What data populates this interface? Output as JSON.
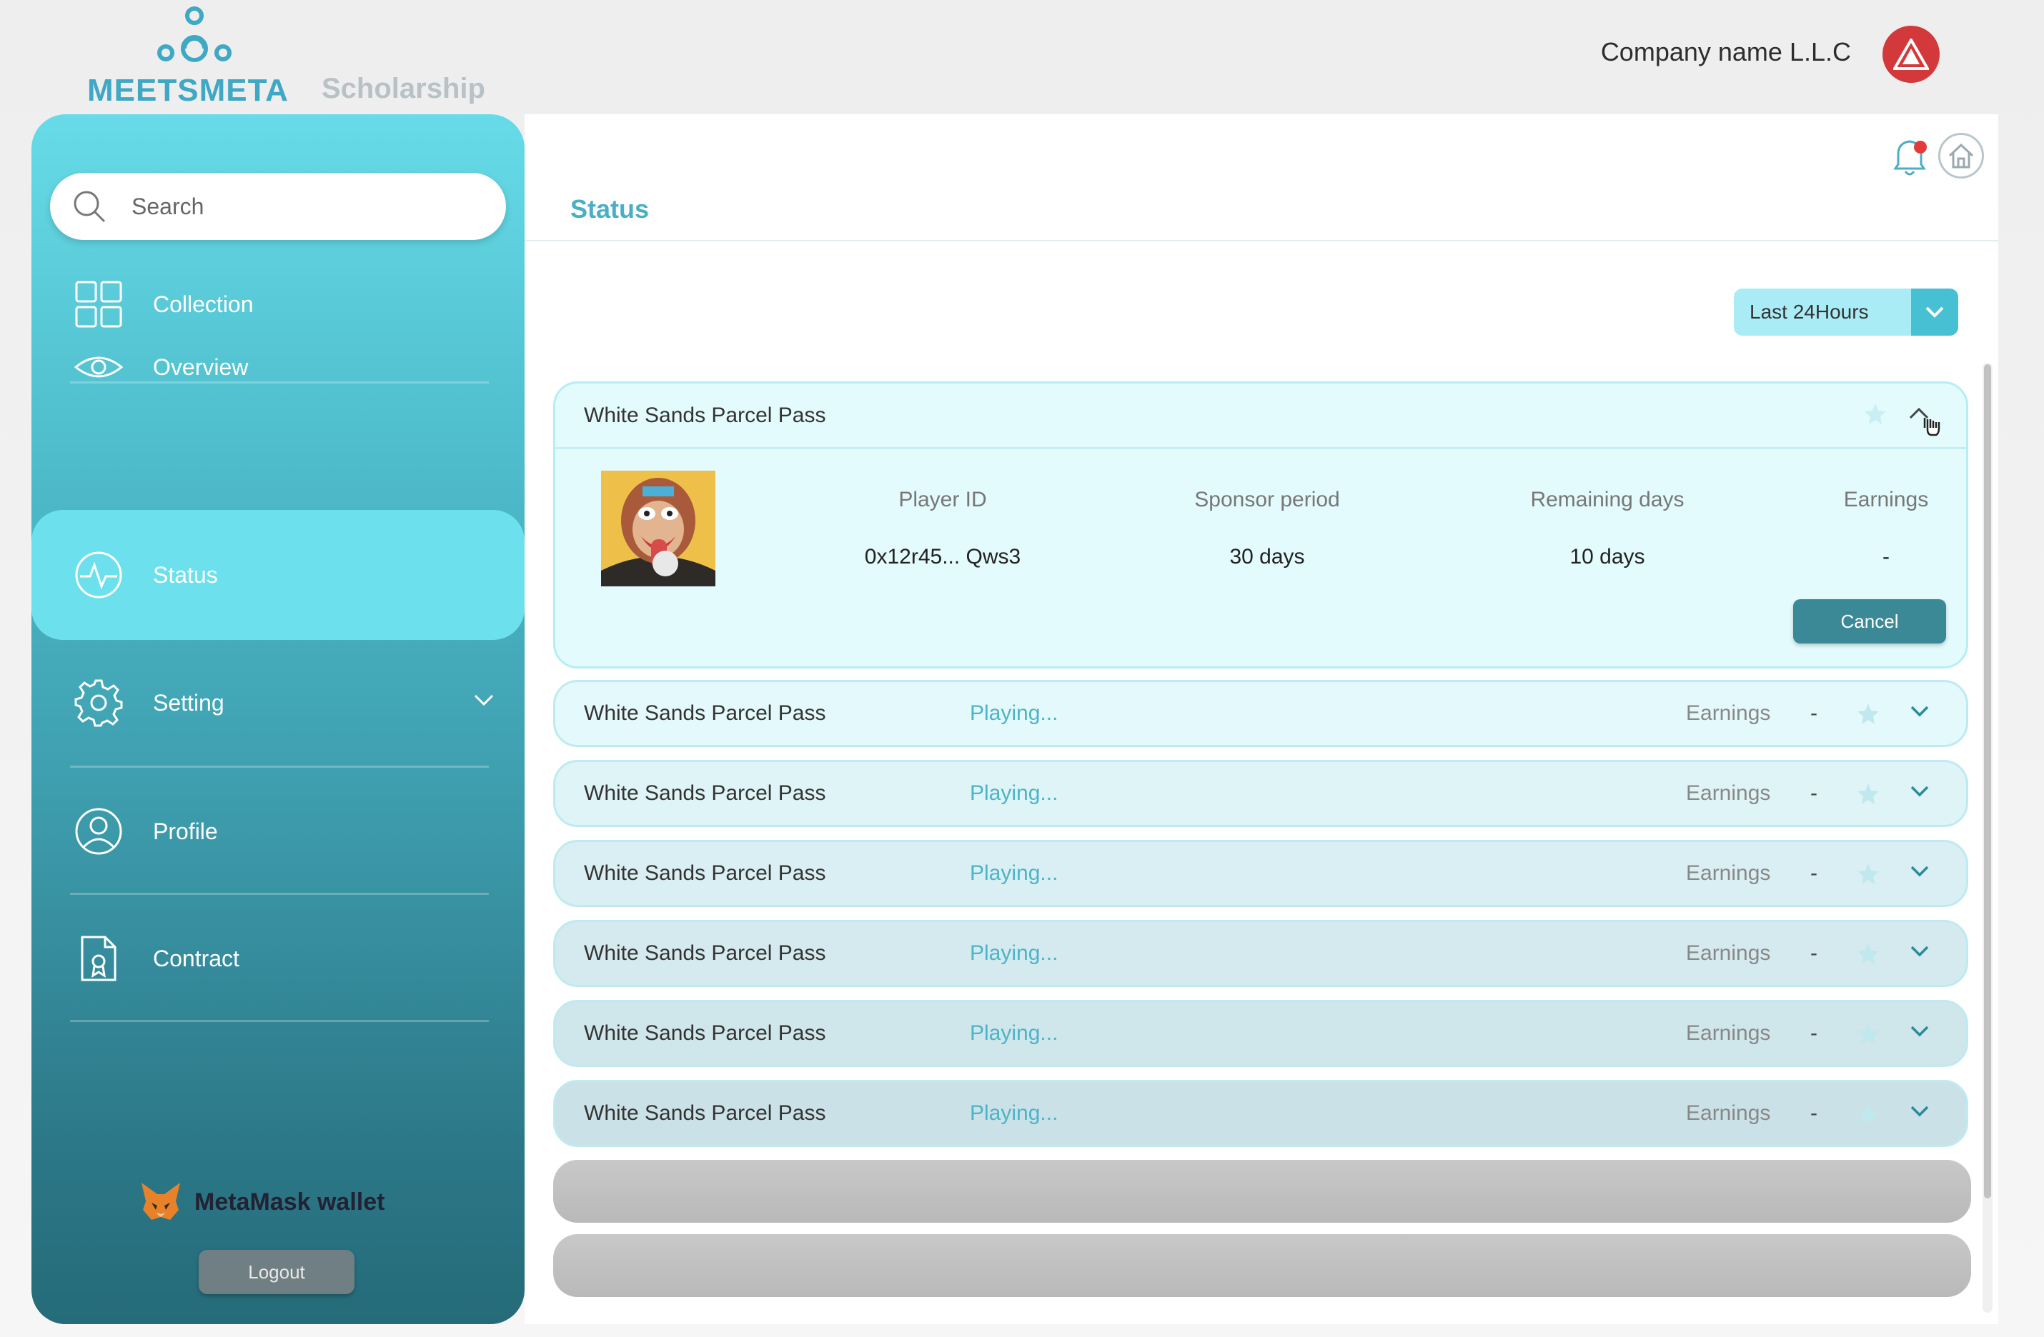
{
  "brand": {
    "name": "MEETSMETA",
    "product": "Scholarship"
  },
  "company": {
    "name": "Company name L.L.C"
  },
  "sidebar": {
    "search_placeholder": "Search",
    "items": [
      {
        "label": "Collection",
        "icon": "grid-icon"
      },
      {
        "label": "Overview",
        "icon": "eye-icon"
      },
      {
        "label": "Status",
        "icon": "activity-icon",
        "active": true
      },
      {
        "label": "Setting",
        "icon": "gear-icon"
      },
      {
        "label": "Profile",
        "icon": "user-circle-icon"
      },
      {
        "label": "Contract",
        "icon": "document-icon"
      }
    ],
    "wallet_label": "MetaMask wallet",
    "logout_label": "Logout"
  },
  "main": {
    "title": "Status",
    "filter": {
      "selected": "Last 24Hours"
    },
    "expanded": {
      "name": "White Sands Parcel Pass",
      "columns": [
        "Player ID",
        "Sponsor period",
        "Remaining days",
        "Earnings"
      ],
      "values": [
        "0x12r45... Qws3",
        "30 days",
        "10 days",
        "-"
      ],
      "cancel_label": "Cancel"
    },
    "rows": [
      {
        "name": "White Sands Parcel Pass",
        "status": "Playing...",
        "earnings_label": "Earnings",
        "earnings": "-"
      },
      {
        "name": "White Sands Parcel Pass",
        "status": "Playing...",
        "earnings_label": "Earnings",
        "earnings": "-"
      },
      {
        "name": "White Sands Parcel Pass",
        "status": "Playing...",
        "earnings_label": "Earnings",
        "earnings": "-"
      },
      {
        "name": "White Sands Parcel Pass",
        "status": "Playing...",
        "earnings_label": "Earnings",
        "earnings": "-"
      },
      {
        "name": "White Sands Parcel Pass",
        "status": "Playing...",
        "earnings_label": "Earnings",
        "earnings": "-"
      },
      {
        "name": "White Sands Parcel Pass",
        "status": "Playing...",
        "earnings_label": "Earnings",
        "earnings": "-"
      }
    ]
  },
  "colors": {
    "accent": "#4aaec4",
    "active_nav": "#6ce0ec",
    "cancel": "#3b8896",
    "notification_dot": "#e33b3b"
  }
}
